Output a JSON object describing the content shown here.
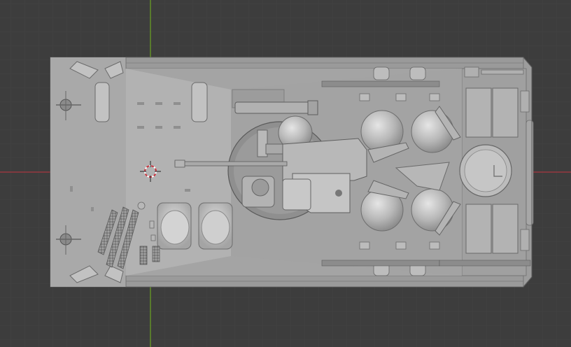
{
  "app": {
    "name": "3D Viewport"
  },
  "viewport": {
    "view": "top-orthographic",
    "background": "#3d3d3d",
    "grid_minor_color": "#454545",
    "grid_major_color": "#2f2f2f",
    "x_axis_color": "#a8353f",
    "y_axis_color": "#6aa321"
  },
  "model": {
    "name": "tracked-vehicle-hull",
    "shading": "solid",
    "base_color": "#a6a6a6",
    "turret": "present",
    "hatches": [
      "rear-hatch-left-top",
      "rear-hatch-right-top",
      "rear-hatch-left-bottom",
      "rear-hatch-right-bottom",
      "commander-hatch",
      "front-round-hatch"
    ]
  },
  "cursor": {
    "name": "3d-cursor"
  }
}
